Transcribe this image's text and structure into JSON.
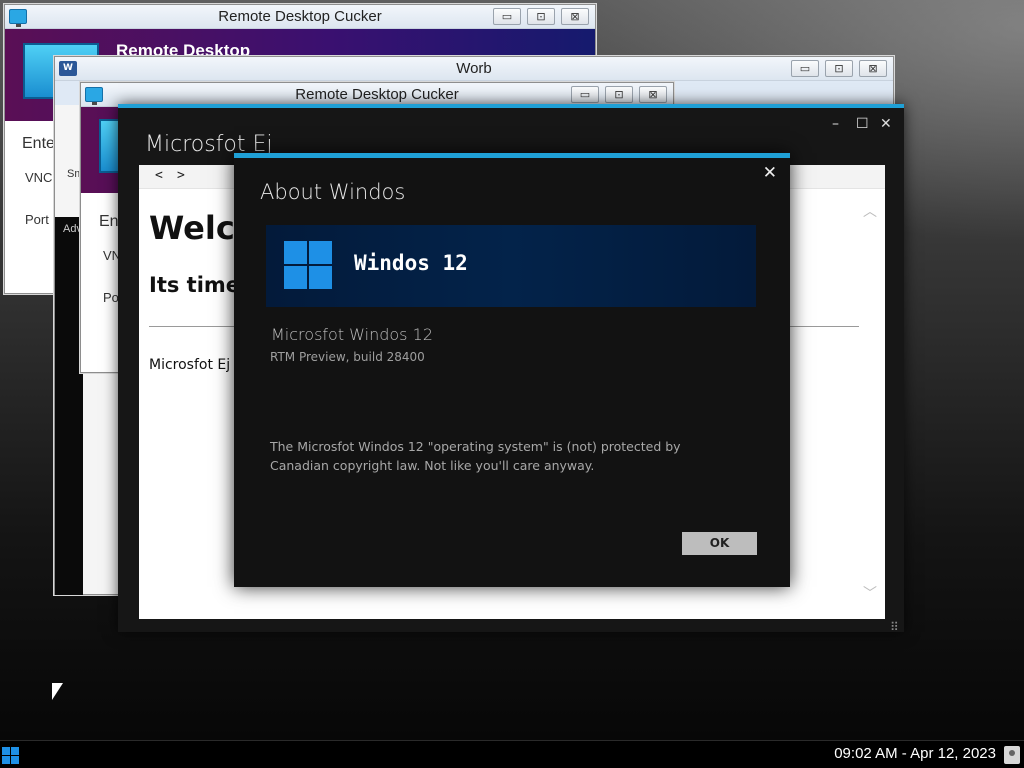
{
  "windows": {
    "rdp_back": {
      "title": "Remote Desktop Cucker",
      "banner_text": "Remote Desktop",
      "enter_label": "Ente",
      "vnc_label": "VNC",
      "port_label": "Port"
    },
    "worb": {
      "title": "Worb",
      "word_icon": "W",
      "sm_label": "Sm",
      "adv_label": "Adv"
    },
    "rdp_front": {
      "title": "Remote Desktop Cucker",
      "enter_label": "En",
      "vnc_label": "VN",
      "port_label": "Po"
    },
    "buttons": {
      "minimize": "▭",
      "maximize": "⊡",
      "close": "⊠"
    }
  },
  "metro_window": {
    "title": "Microsfot Ej",
    "controls": {
      "minimize": "–",
      "maximize": "☐",
      "close": "✕"
    },
    "nav": {
      "back": "<",
      "forward": ">"
    },
    "page": {
      "heading": "Welcome to Microsfot Ej",
      "subheading": "Its time to use Microsfot Ej",
      "body": "Microsfot Ej"
    },
    "scroll": {
      "up": "︿",
      "down": "﹀"
    },
    "grip": "⠿"
  },
  "about_dialog": {
    "title": "About Windos",
    "close": "✕",
    "product_name": "Windos 12",
    "product_full": "Microsfot Windos 12",
    "build": "RTM Preview, build 28400",
    "legal": "The Microsfot Windos 12 \"operating system\" is (not) protected by Canadian copyright law. Not like you'll care anyway.",
    "ok_label": "OK"
  },
  "taskbar": {
    "clock": "09:02 AM - Apr 12, 2023"
  },
  "colors": {
    "accent": "#1fa0d6",
    "logo_blue": "#1e90e6",
    "dialog_bg": "#121212",
    "hero_bg": "#03234a"
  }
}
